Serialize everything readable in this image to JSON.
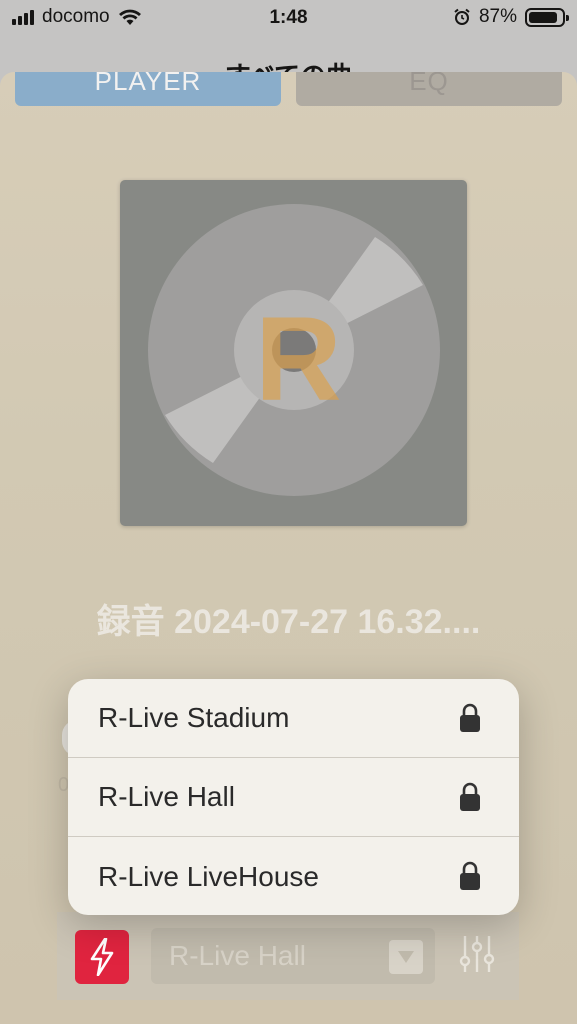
{
  "status_bar": {
    "carrier": "docomo",
    "time": "1:48",
    "battery_percent": "87%",
    "battery_level": 0.87
  },
  "nav": {
    "title": "すべての曲"
  },
  "tabs": [
    {
      "label": "PLAYER",
      "active": true
    },
    {
      "label": "EQ",
      "active": false
    }
  ],
  "player": {
    "song_title": "録音 2024-07-27 16.32....",
    "elapsed_time": "0"
  },
  "bottom_bar": {
    "power_icon": "lightning-bolt-icon",
    "selected_preset": "R-Live Hall",
    "equalizer_icon": "sliders-icon"
  },
  "preset_menu": {
    "items": [
      {
        "label": "R-Live Stadium",
        "icon": "lock-icon"
      },
      {
        "label": "R-Live Hall",
        "icon": "lock-icon"
      },
      {
        "label": "R-Live LiveHouse",
        "icon": "lock-icon"
      }
    ]
  },
  "colors": {
    "tab_active": "#8fb6d6",
    "power_button": "#e0243f",
    "sheet_bg": "#e2d8c3",
    "menu_bg": "#f3f1eb"
  }
}
